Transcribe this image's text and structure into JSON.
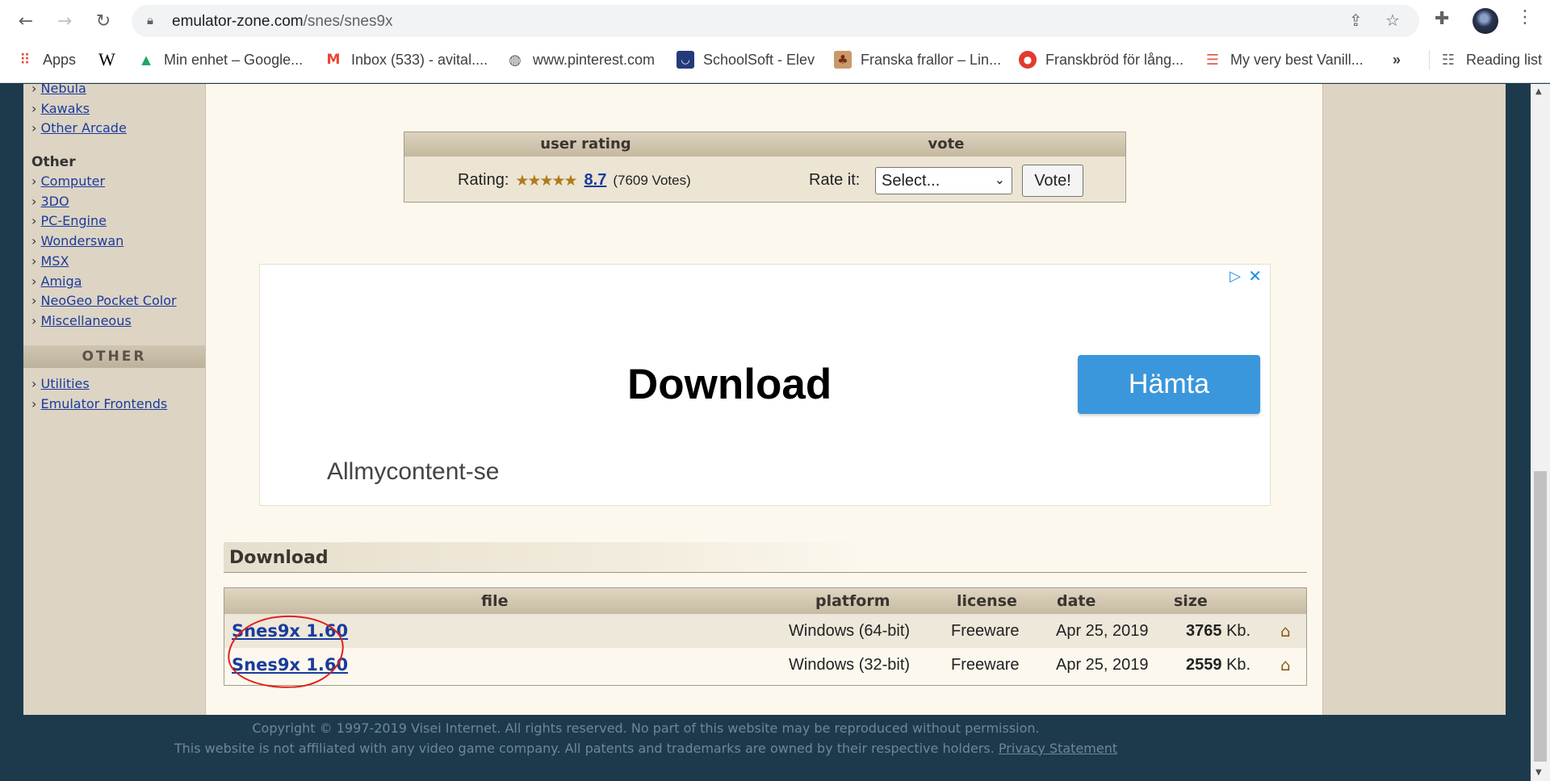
{
  "browser": {
    "url_host": "emulator-zone.com",
    "url_path": "/snes/snes9x",
    "bookmarks": [
      {
        "label": "Apps",
        "icon": "apps-grid-icon"
      },
      {
        "label": "W",
        "icon": "wikipedia-icon"
      },
      {
        "label": "Min enhet – Google...",
        "icon": "google-drive-icon"
      },
      {
        "label": "Inbox (533) - avital....",
        "icon": "gmail-icon"
      },
      {
        "label": "www.pinterest.com",
        "icon": "globe-icon"
      },
      {
        "label": "SchoolSoft - Elev",
        "icon": "schoolsoft-icon"
      },
      {
        "label": "Franska frallor – Lin...",
        "icon": "recipe-icon"
      },
      {
        "label": "Franskbröd för lång...",
        "icon": "recipe-red-icon"
      },
      {
        "label": "My very best Vanill...",
        "icon": "recipe-stripe-icon"
      }
    ],
    "more_bookmarks": "»",
    "reading_list": "Reading list"
  },
  "sidebar": {
    "arcade_items": [
      "Nebula",
      "Kawaks",
      "Other Arcade"
    ],
    "other_group_title": "Other",
    "other_items": [
      "Computer",
      "3DO",
      "PC-Engine",
      "Wonderswan",
      "MSX",
      "Amiga",
      "NeoGeo Pocket Color",
      "Miscellaneous"
    ],
    "section_header": "OTHER",
    "tools_items": [
      "Utilities",
      "Emulator Frontends"
    ],
    "bullet": "›"
  },
  "rating": {
    "col_user_rating": "user rating",
    "col_vote": "vote",
    "rating_label": "Rating:",
    "stars": "★★★★★",
    "score": "8.7",
    "votes": "(7609 Votes)",
    "rate_it_label": "Rate it:",
    "select_value": "Select...",
    "vote_button": "Vote!"
  },
  "ad": {
    "headline": "Download",
    "button": "Hämta",
    "source": "Allmycontent-se",
    "accent_color": "#3a97dc"
  },
  "download": {
    "section_title": "Download",
    "headers": {
      "file": "file",
      "platform": "platform",
      "license": "license",
      "date": "date",
      "size": "size"
    },
    "rows": [
      {
        "file": "Snes9x 1.60",
        "platform": "Windows (64-bit)",
        "license": "Freeware",
        "date": "Apr 25, 2019",
        "size": "3765",
        "unit": "Kb."
      },
      {
        "file": "Snes9x 1.60",
        "platform": "Windows (32-bit)",
        "license": "Freeware",
        "date": "Apr 25, 2019",
        "size": "2559",
        "unit": "Kb."
      }
    ]
  },
  "footer": {
    "line1": "Copyright © 1997-2019 Visei Internet. All rights reserved. No part of this website may be reproduced without permission.",
    "line2": "This website is not affiliated with any video game company. All patents and trademarks are owned by their respective holders.",
    "privacy_link": "Privacy Statement"
  }
}
